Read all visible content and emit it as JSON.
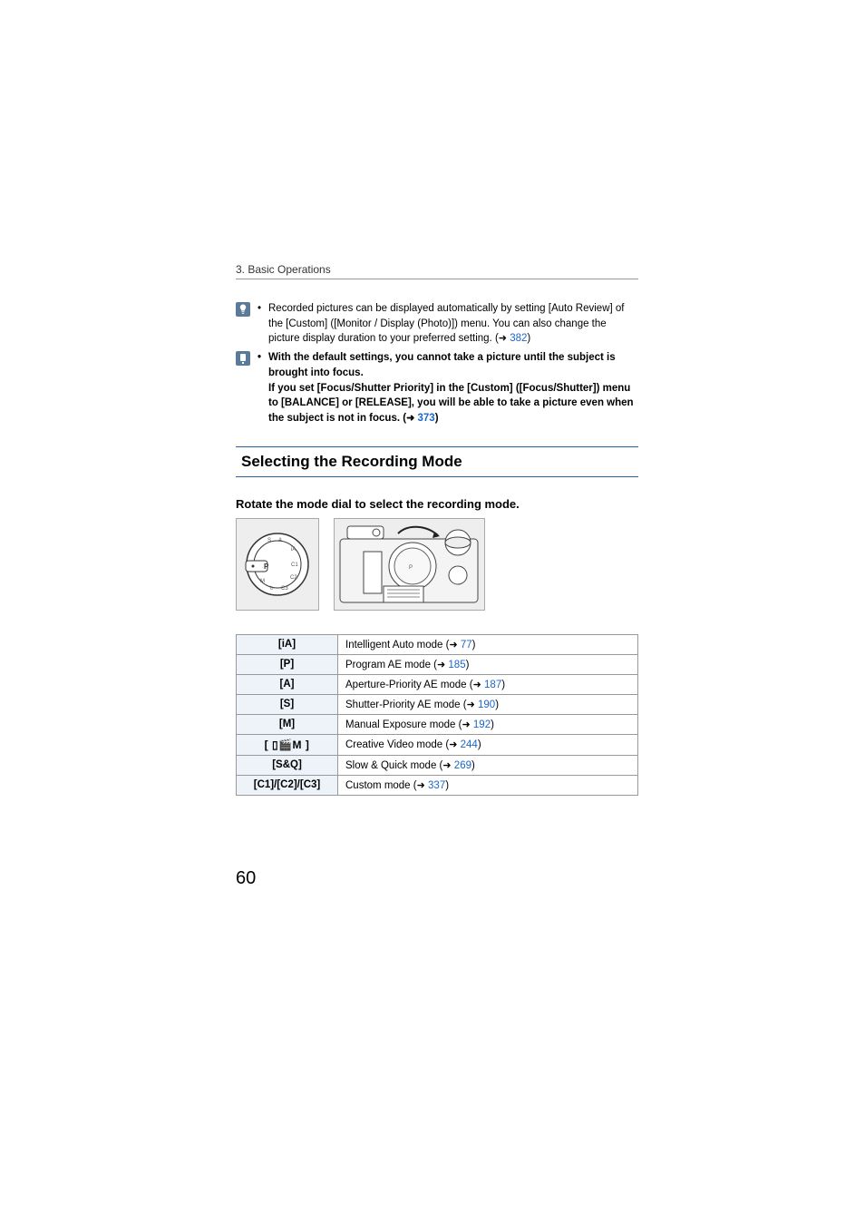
{
  "header": {
    "chapter": "3. Basic Operations"
  },
  "notes": {
    "auto_review": {
      "text_a": "Recorded pictures can be displayed automatically by setting [Auto Review] of the [Custom] ([Monitor / Display (Photo)]) menu. You can also change the picture display duration to your preferred setting. (",
      "page": "382",
      "text_b": ")"
    },
    "default_focus": {
      "line1": "With the default settings, you cannot take a picture until the subject is brought into focus.",
      "line2_a": "If you set [Focus/Shutter Priority] in the [Custom] ([Focus/Shutter]) menu to [BALANCE] or [RELEASE], you will be able to take a picture even when the subject is not in focus. (",
      "page": "373",
      "line2_b": ")"
    }
  },
  "section": {
    "title": "Selecting the Recording Mode",
    "subheading": "Rotate the mode dial to select the recording mode."
  },
  "table": {
    "rows": [
      {
        "mode": "[iA]",
        "label": "Intelligent Auto mode (",
        "page": "77"
      },
      {
        "mode": "[P]",
        "label": "Program AE mode (",
        "page": "185"
      },
      {
        "mode": "[A]",
        "label": "Aperture-Priority AE mode (",
        "page": "187"
      },
      {
        "mode": "[S]",
        "label": "Shutter-Priority AE mode (",
        "page": "190"
      },
      {
        "mode": "[M]",
        "label": "Manual Exposure mode (",
        "page": "192"
      },
      {
        "mode": "video-m",
        "label": "Creative Video mode (",
        "page": "244"
      },
      {
        "mode": "[S&Q]",
        "label": "Slow & Quick mode (",
        "page": "269"
      },
      {
        "mode": "[C1]/[C2]/[C3]",
        "label": "Custom mode (",
        "page": "337"
      }
    ],
    "close_paren": ")"
  },
  "page_number": "60"
}
